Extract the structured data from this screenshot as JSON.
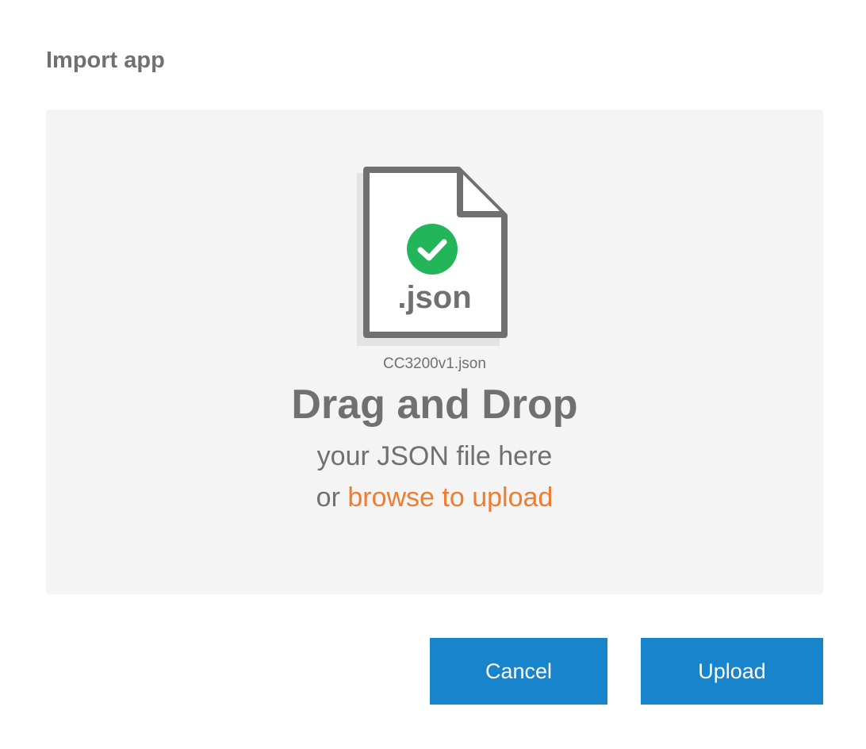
{
  "dialog": {
    "title": "Import app"
  },
  "dropzone": {
    "file_extension": ".json",
    "file_name": "CC3200v1.json",
    "heading": "Drag and Drop",
    "subtext": "your JSON file here",
    "browse_prefix": "or ",
    "browse_link": "browse to upload",
    "icons": {
      "file": "file-icon",
      "status": "check-circle-icon"
    }
  },
  "actions": {
    "cancel_label": "Cancel",
    "upload_label": "Upload"
  },
  "colors": {
    "accent_button": "#1784cc",
    "link": "#ef7d31",
    "success": "#23b55a",
    "text": "#707070",
    "dropzone_bg": "#f4f4f4"
  }
}
